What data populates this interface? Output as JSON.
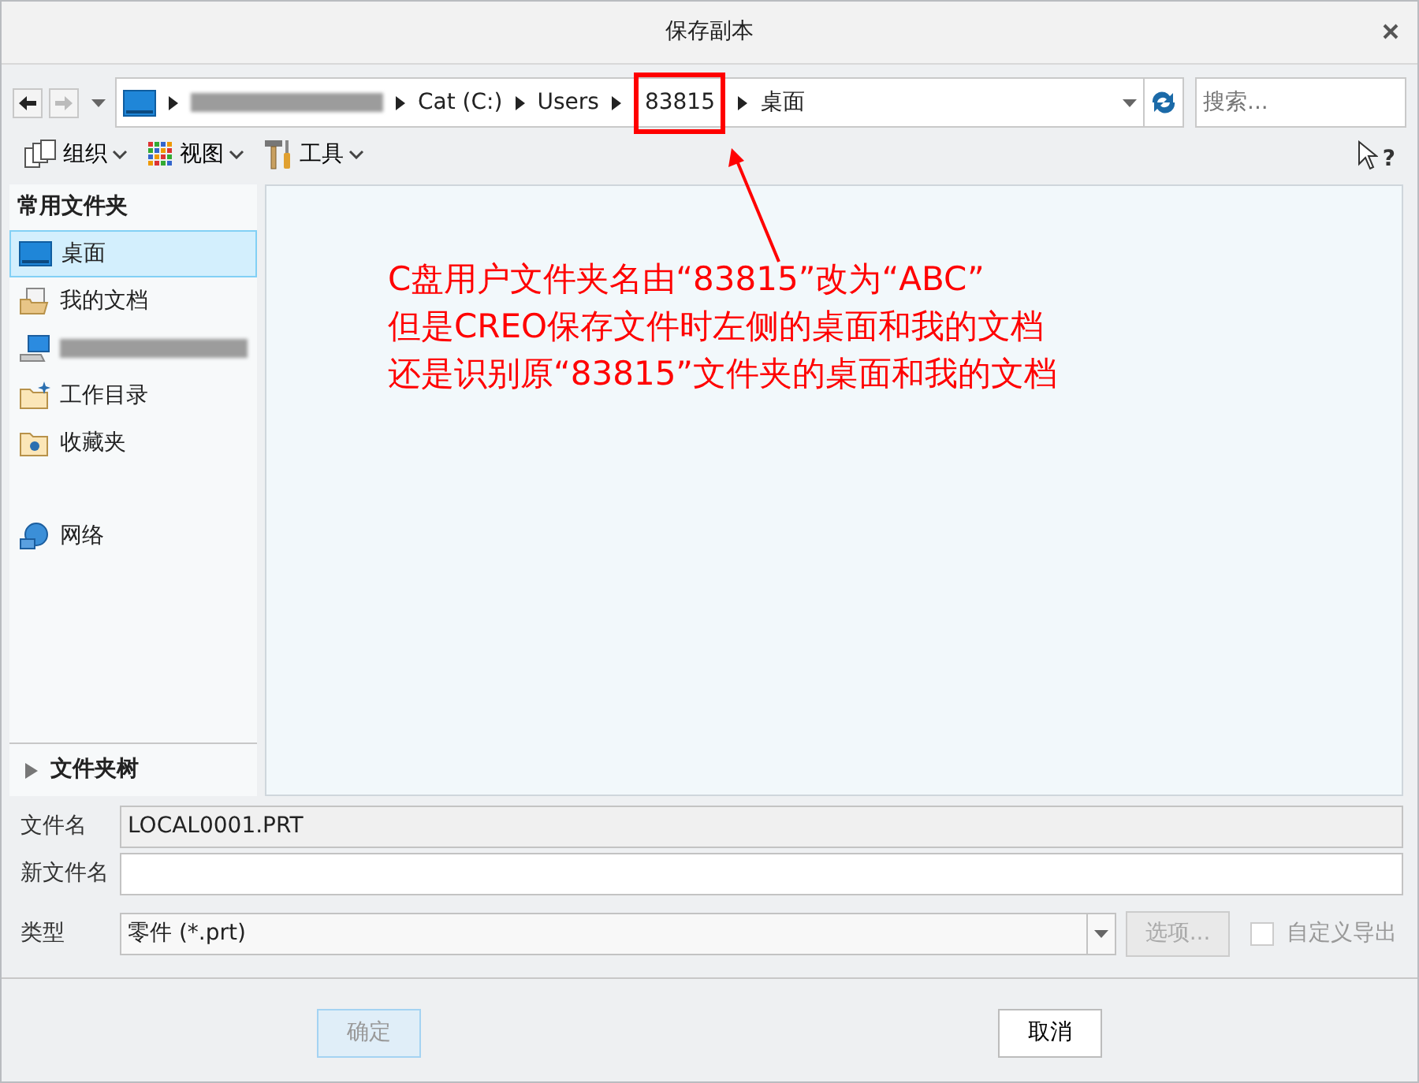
{
  "window": {
    "title": "保存副本"
  },
  "address": {
    "crumbs": [
      {
        "kind": "redacted",
        "highlighted": false
      },
      {
        "kind": "text",
        "label": "Cat (C:)",
        "highlighted": false
      },
      {
        "kind": "text",
        "label": "Users",
        "highlighted": false
      },
      {
        "kind": "text",
        "label": "83815",
        "highlighted": true
      },
      {
        "kind": "text",
        "label": "桌面",
        "highlighted": false
      }
    ]
  },
  "search": {
    "placeholder": "搜索..."
  },
  "help_button": {
    "label": "?"
  },
  "toolbar": [
    {
      "kind": "organize",
      "label": "组织"
    },
    {
      "kind": "view",
      "label": "视图"
    },
    {
      "kind": "tools",
      "label": "工具"
    }
  ],
  "sidebar": {
    "heading": "常用文件夹",
    "items": [
      {
        "kind": "desktop",
        "label": "桌面",
        "selected": true
      },
      {
        "kind": "documents",
        "label": "我的文档",
        "selected": false
      },
      {
        "kind": "computer",
        "selected": false
      },
      {
        "kind": "workdir",
        "label": "工作目录",
        "selected": false
      },
      {
        "kind": "favorites",
        "label": "收藏夹",
        "selected": false
      },
      {
        "kind": "network",
        "label": "网络",
        "selected": false
      }
    ],
    "folder_tree": {
      "label": "文件夹树",
      "expanded": false
    }
  },
  "annotation": {
    "lines": [
      "C盘用户文件夹名由“83815”改为“ABC”",
      "但是CREO保存文件时左侧的桌面和我的文档",
      "还是识别原“83815”文件夹的桌面和我的文档"
    ]
  },
  "form": {
    "file_name": {
      "label": "文件名",
      "value": "LOCAL0001.PRT"
    },
    "new_file_name": {
      "label": "新文件名"
    },
    "type": {
      "label": "类型",
      "value": "零件 (*.prt)"
    },
    "options_button": {
      "label": "选项...",
      "disabled": true
    },
    "custom_export": {
      "label": "自定义导出",
      "checked": false,
      "disabled": true
    }
  },
  "buttons": [
    {
      "label": "确定",
      "disabled": true
    },
    {
      "label": "取消",
      "disabled": false
    }
  ]
}
